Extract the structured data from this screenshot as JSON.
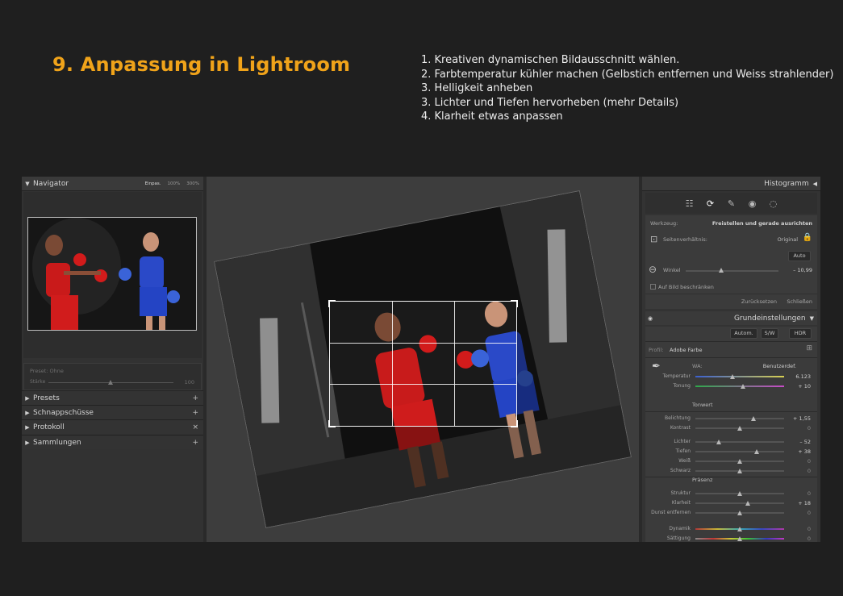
{
  "page": {
    "title": "9. Anpassung in Lightroom",
    "steps": [
      "1. Kreativen dynamischen Bildausschnitt wählen.",
      "2. Farbtemperatur kühler machen (Gelbstich entfernen und Weiss strahlender)",
      "3. Helligkeit anheben",
      "3. Lichter und Tiefen hervorheben (mehr Details)",
      "4. Klarheit etwas anpassen"
    ]
  },
  "left_panel": {
    "navigator": {
      "label": "Navigator",
      "zoom": [
        "Einpas.",
        "100%",
        "300%"
      ]
    },
    "preset": {
      "label": "Preset: Ohne",
      "amount_label": "Stärke",
      "amount_value": "100"
    },
    "sections": [
      {
        "label": "Presets",
        "action": "+"
      },
      {
        "label": "Schnappschüsse",
        "action": "+"
      },
      {
        "label": "Protokoll",
        "action": "×"
      },
      {
        "label": "Sammlungen",
        "action": "+"
      }
    ]
  },
  "right_panel": {
    "histogram_label": "Histogramm",
    "crop": {
      "werkzeug_label": "Werkzeug:",
      "werkzeug_value": "Freistellen und gerade ausrichten",
      "ratio_label": "Seitenverhältnis:",
      "ratio_value": "Original",
      "auto_label": "Auto",
      "angle_label": "Winkel",
      "angle_value": "– 10,99",
      "angle_level": 0.38,
      "constrain_label": "Auf Bild beschränken",
      "reset_label": "Zurücksetzen",
      "close_label": "Schließen"
    },
    "basic": {
      "header": "Grundeinstellungen",
      "buttons": [
        "Autom.",
        "S/W",
        "HDR"
      ],
      "profile_label": "Profil:",
      "profile_value": "Adobe Farbe",
      "wb_label": "WA:",
      "wb_value": "Benutzerdef.",
      "tonwert_label": "Tonwert",
      "praesenz_label": "Präsenz",
      "sliders": [
        {
          "label": "Temperatur",
          "value": "6.123",
          "level": 0.42,
          "group": "wb"
        },
        {
          "label": "Tonung",
          "value": "+ 10",
          "level": 0.54,
          "group": "wb"
        },
        {
          "label": "Belichtung",
          "value": "+ 1,55",
          "level": 0.65,
          "group": "tone"
        },
        {
          "label": "Kontrast",
          "value": "0",
          "level": 0.5,
          "group": "tone"
        },
        {
          "label": "Lichter",
          "value": "– 52",
          "level": 0.26,
          "group": "tone"
        },
        {
          "label": "Tiefen",
          "value": "+ 38",
          "level": 0.69,
          "group": "tone"
        },
        {
          "label": "Weiß",
          "value": "0",
          "level": 0.5,
          "group": "tone"
        },
        {
          "label": "Schwarz",
          "value": "0",
          "level": 0.5,
          "group": "tone"
        },
        {
          "label": "Struktur",
          "value": "0",
          "level": 0.5,
          "group": "presence"
        },
        {
          "label": "Klarheit",
          "value": "+ 18",
          "level": 0.59,
          "group": "presence"
        },
        {
          "label": "Dunst entfernen",
          "value": "0",
          "level": 0.5,
          "group": "presence"
        },
        {
          "label": "Dynamik",
          "value": "0",
          "level": 0.5,
          "group": "presence"
        },
        {
          "label": "Sättigung",
          "value": "0",
          "level": 0.5,
          "group": "presence"
        }
      ]
    }
  },
  "colors": {
    "accent": "#f0a31a",
    "background": "#1f1f1f"
  }
}
